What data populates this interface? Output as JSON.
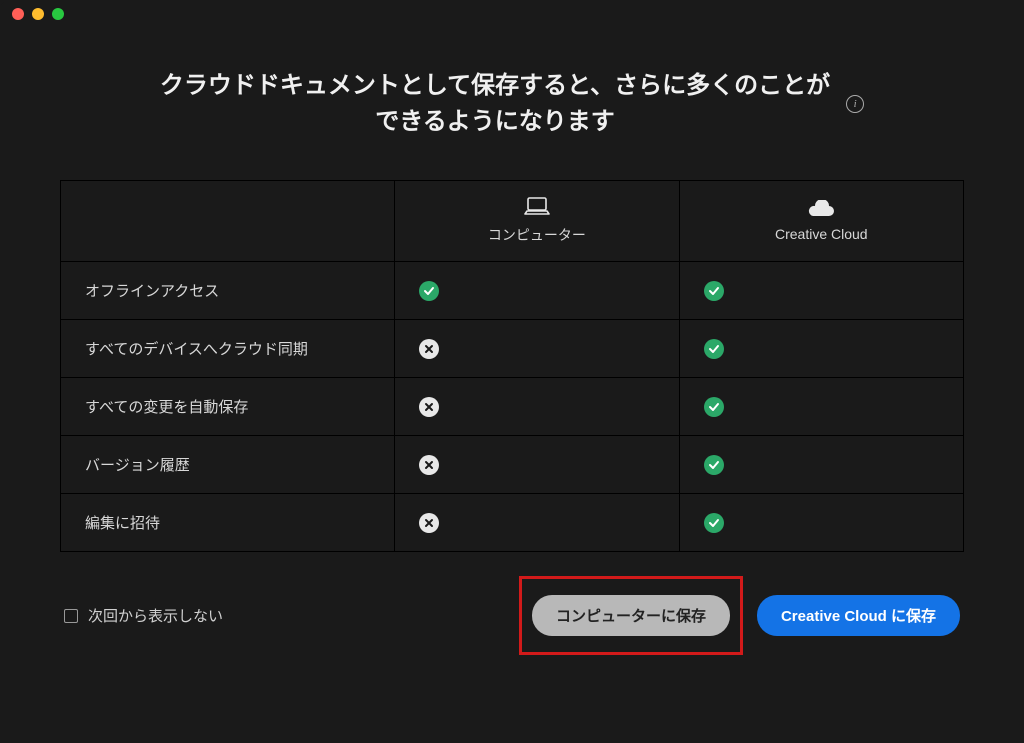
{
  "title_line1": "クラウドドキュメントとして保存すると、さらに多くのことが",
  "title_line2": "できるようになります",
  "columns": {
    "computer": "コンピューター",
    "cloud": "Creative Cloud"
  },
  "features": [
    {
      "label": "オフラインアクセス",
      "computer": true,
      "cloud": true
    },
    {
      "label": "すべてのデバイスへクラウド同期",
      "computer": false,
      "cloud": true
    },
    {
      "label": "すべての変更を自動保存",
      "computer": false,
      "cloud": true
    },
    {
      "label": "バージョン履歴",
      "computer": false,
      "cloud": true
    },
    {
      "label": "編集に招待",
      "computer": false,
      "cloud": true
    }
  ],
  "footer": {
    "dont_show_again": "次回から表示しない",
    "save_to_computer": "コンピューターに保存",
    "save_to_cloud": "Creative Cloud に保存"
  }
}
